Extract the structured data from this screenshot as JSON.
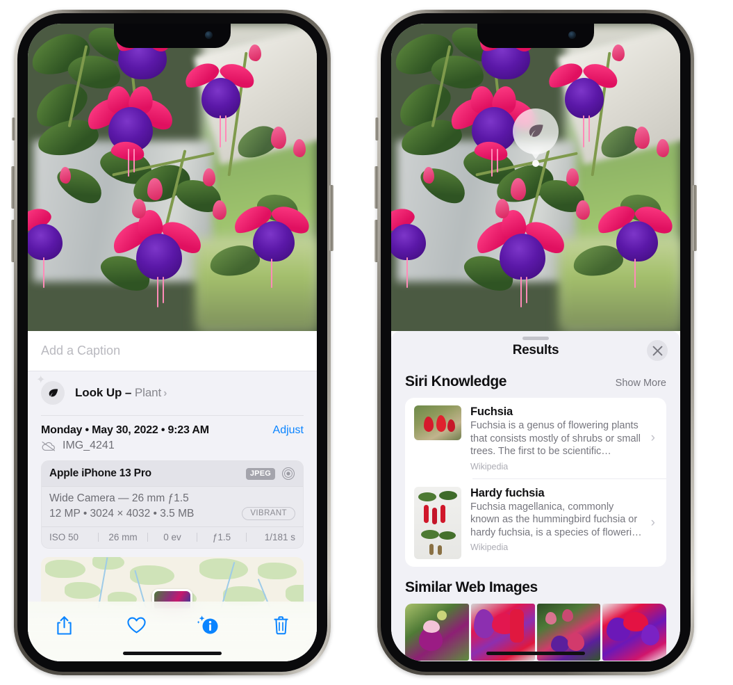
{
  "left_phone": {
    "caption_field": {
      "placeholder": "Add a Caption",
      "value": ""
    },
    "lookup_row": {
      "label": "Look Up",
      "dash": " – ",
      "subject": "Plant",
      "chevron": "›",
      "icon": "leaf-icon",
      "sparkle_icon": "sparkle-icon"
    },
    "date_row": {
      "date": "Monday • May 30, 2022 • 9:23 AM",
      "adjust": "Adjust"
    },
    "file_row": {
      "icon": "icloud-slash-icon",
      "filename": "IMG_4241"
    },
    "camera_card": {
      "model": "Apple iPhone 13 Pro",
      "format_badge": "JPEG",
      "aperture_icon": "aperture-icon",
      "lens_line": "Wide Camera — 26 mm ƒ1.5",
      "specs_line": "12 MP • 3024 × 4032 • 3.5 MB",
      "style_badge": "VIBRANT",
      "exif": [
        "ISO 50",
        "26 mm",
        "0 ev",
        "ƒ1.5",
        "1/181 s"
      ]
    },
    "toolbar": {
      "items": [
        {
          "name": "share-icon",
          "label": "Share"
        },
        {
          "name": "heart-icon",
          "label": "Favorite"
        },
        {
          "name": "info-sparkle-icon",
          "label": "Info"
        },
        {
          "name": "trash-icon",
          "label": "Delete"
        }
      ]
    }
  },
  "right_phone": {
    "visual_lookup_badge": {
      "icon": "leaf-icon"
    },
    "sheet": {
      "title": "Results",
      "close_icon": "close-icon",
      "sections": [
        {
          "title": "Siri Knowledge",
          "action": "Show More",
          "items": [
            {
              "title": "Fuchsia",
              "description": "Fuchsia is a genus of flowering plants that consists mostly of shrubs or small trees. The first to be scientific…",
              "source": "Wikipedia",
              "chevron": "›"
            },
            {
              "title": "Hardy fuchsia",
              "description": "Fuchsia magellanica, commonly known as the hummingbird fuchsia or hardy fuchsia, is a species of floweri…",
              "source": "Wikipedia",
              "chevron": "›"
            }
          ]
        },
        {
          "title": "Similar Web Images",
          "thumbnails": [
            "web-image-1",
            "web-image-2",
            "web-image-3",
            "web-image-4"
          ]
        }
      ]
    }
  },
  "colors": {
    "accent_blue": "#0a84ff",
    "panel_bg": "#f2f2f7",
    "sheet_bg": "#f1f1f6",
    "card_bg": "#ffffff",
    "text_primary": "#111113",
    "text_secondary": "#76767e"
  }
}
